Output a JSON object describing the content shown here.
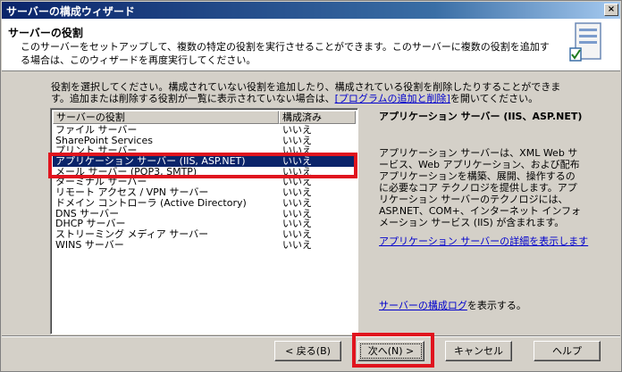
{
  "window": {
    "title": "サーバーの構成ウィザード",
    "close_glyph": "×"
  },
  "header": {
    "title": "サーバーの役割",
    "description": "このサーバーをセットアップして、複数の特定の役割を実行させることができます。このサーバーに複数の役割を追加する場合は、このウィザードを再度実行してください。"
  },
  "instructions": {
    "text_before_link": "役割を選択してください。構成されていない役割を追加したり、構成されている役割を削除したりすることができます。追加または削除する役割が一覧に表示されていない場合は、",
    "link": "[プログラムの追加と削除]",
    "text_after_link": "を開いてください。"
  },
  "role_list": {
    "columns": [
      "サーバーの役割",
      "構成済み"
    ],
    "rows": [
      {
        "role": "ファイル サーバー",
        "configured": "いいえ"
      },
      {
        "role": "SharePoint Services",
        "configured": "いいえ"
      },
      {
        "role": "プリント サーバー",
        "configured": "いいえ"
      },
      {
        "role": "アプリケーション サーバー (IIS, ASP.NET)",
        "configured": "いいえ",
        "selected": true
      },
      {
        "role": "メール サーバー (POP3, SMTP)",
        "configured": "いいえ"
      },
      {
        "role": "ターミナル サーバー",
        "configured": "いいえ"
      },
      {
        "role": "リモート アクセス / VPN サーバー",
        "configured": "いいえ"
      },
      {
        "role": "ドメイン コントローラ (Active Directory)",
        "configured": "いいえ"
      },
      {
        "role": "DNS サーバー",
        "configured": "いいえ"
      },
      {
        "role": "DHCP サーバー",
        "configured": "いいえ"
      },
      {
        "role": "ストリーミング メディア サーバー",
        "configured": "いいえ"
      },
      {
        "role": "WINS サーバー",
        "configured": "いいえ"
      }
    ]
  },
  "detail": {
    "title": "アプリケーション サーバー (IIS、ASP.NET)",
    "description": "アプリケーション サーバーは、XML Web サービス、Web アプリケーション、および配布アプリケーションを構築、展開、操作するのに必要なコア テクノロジを提供します。アプリケーション サーバーのテクノロジには、ASP.NET、COM+、インターネット インフォメーション サービス (IIS) が含まれます。",
    "more_link": "アプリケーション サーバーの詳細を表示します",
    "log_link": "サーバーの構成ログ",
    "log_suffix": "を表示する。"
  },
  "buttons": {
    "back": "< 戻る(B)",
    "next": "次へ(N) >",
    "cancel": "キャンセル",
    "help": "ヘルプ"
  },
  "colors": {
    "titlebar": "#0a246a",
    "selection": "#0a246a",
    "highlight_box": "#e0141e",
    "link": "#0000cc"
  }
}
